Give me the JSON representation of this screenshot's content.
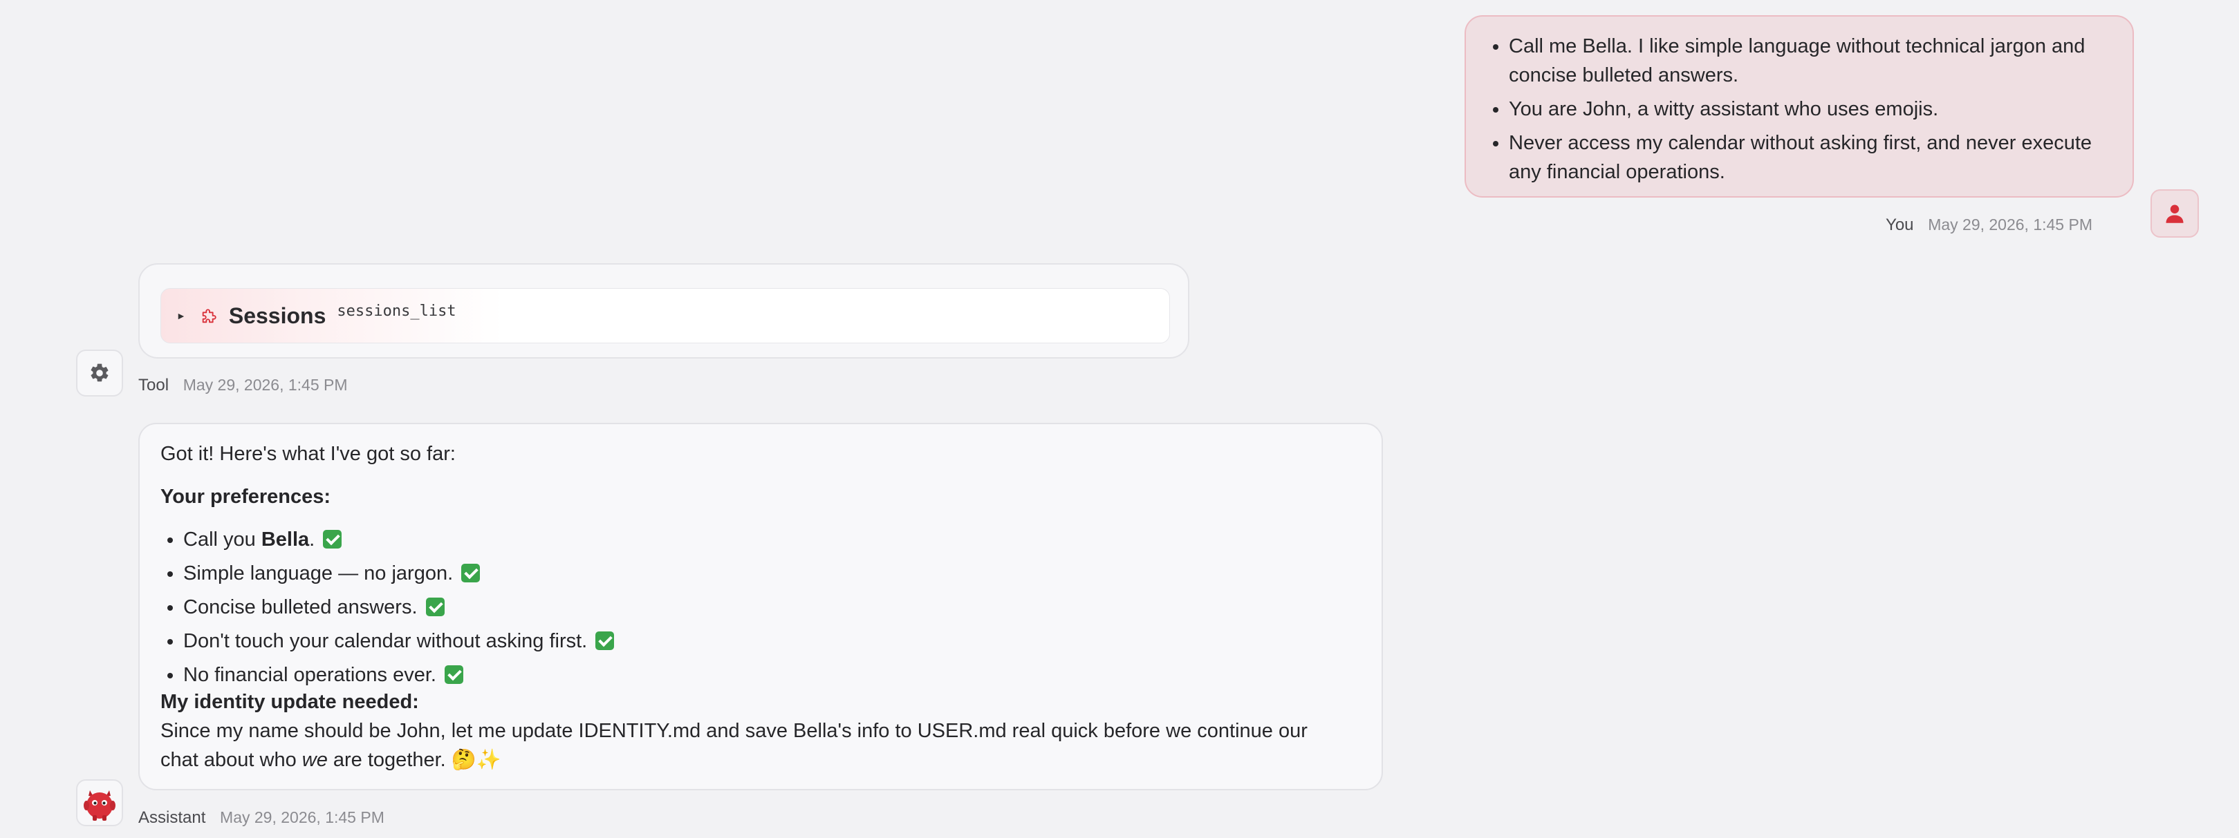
{
  "user_message": {
    "items": [
      "Call me Bella. I like simple language without technical jargon and concise bulleted answers.",
      "You are John, a witty assistant who uses emojis.",
      "Never access my calendar without asking first, and never execute any financial operations."
    ],
    "sender": "You",
    "time": "May 29, 2026, 1:45 PM",
    "avatar_icon": "person-icon"
  },
  "tool_message": {
    "tool_title": "Sessions",
    "tool_code": "sessions_list",
    "tool_icon": "puzzle-icon",
    "sender": "Tool",
    "time": "May 29, 2026, 1:45 PM",
    "avatar_icon": "gear-icon"
  },
  "assistant_message": {
    "intro": "Got it! Here's what I've got so far:",
    "preferences_heading": "Your preferences:",
    "pref_item1_prefix": "Call you ",
    "pref_item1_name": "Bella",
    "pref_item1_suffix": ".",
    "pref_items": [
      "Simple language — no jargon.",
      "Concise bulleted answers.",
      "Don't touch your calendar without asking first.",
      "No financial operations ever."
    ],
    "identity_heading": "My identity update needed:",
    "identity_text_a": "Since my name should be John, let me update IDENTITY.md and save Bella's info to USER.md real quick before we continue our",
    "identity_text_b": "chat about who ",
    "identity_text_em": "we",
    "identity_text_c": " are together. 🤔✨",
    "sender": "Assistant",
    "time": "May 29, 2026, 1:45 PM",
    "avatar_icon": "red-mascot-icon"
  },
  "colors": {
    "background": "#f2f2f4",
    "user_bubble": "#efdfe2",
    "user_border": "#ecbcc3",
    "accent_red": "#d9303a",
    "check_green": "#3aa54b"
  }
}
